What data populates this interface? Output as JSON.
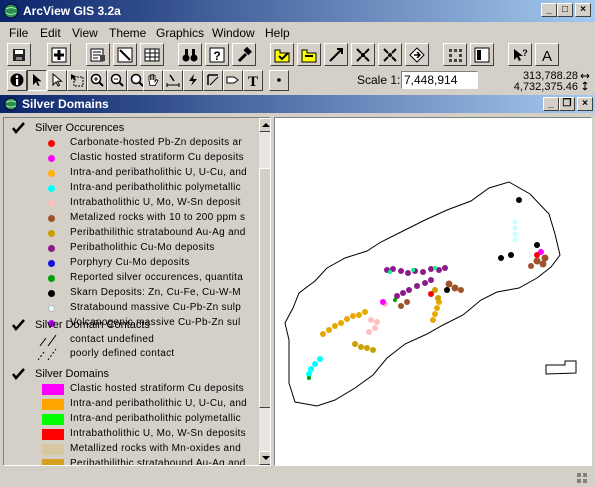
{
  "app": {
    "title": "ArcView GIS 3.2a"
  },
  "menu": [
    "File",
    "Edit",
    "View",
    "Theme",
    "Graphics",
    "Window",
    "Help"
  ],
  "toolbar": {
    "scale_label": "Scale 1:",
    "scale_value": "7,448,914",
    "coord_x": "313,788.28",
    "coord_y": "4,732,375.46"
  },
  "view": {
    "title": "Silver Domains",
    "themes": [
      {
        "name": "Silver Occurences",
        "checked": true,
        "items": [
          {
            "label": "Carbonate-hosted Pb-Zn deposits ar",
            "color": "#ff0000"
          },
          {
            "label": "Clastic hosted stratiform Cu deposits",
            "color": "#ff00ff"
          },
          {
            "label": "Intra-and peribatholithic U, U-Cu, and",
            "color": "#ffb000"
          },
          {
            "label": "Intra-and peribatholithic polymetallic",
            "color": "#00ffff"
          },
          {
            "label": "Intrabatholithic U, Mo, W-Sn deposit",
            "color": "#ffc0c0"
          },
          {
            "label": "Metalized rocks with 10 to 200 ppm s",
            "color": "#a0522d"
          },
          {
            "label": "Peribathilithic stratabound Au-Ag and",
            "color": "#c8a000"
          },
          {
            "label": "Peribatholithic Cu-Mo deposits",
            "color": "#8b1a8b"
          },
          {
            "label": "Porphyry Cu-Mo deposits",
            "color": "#1010e0"
          },
          {
            "label": "Reported silver occurences, quantita",
            "color": "#00a000"
          },
          {
            "label": "Skarn Deposits: Zn, Cu-Fe, Cu-W-M",
            "color": "#000000"
          },
          {
            "label": "Stratabound massive Cu-Pb-Zn sulp",
            "color": "#e0ffff"
          },
          {
            "label": "Volcanogenic massive Cu-Pb-Zn sul",
            "color": "#c000ff"
          }
        ]
      },
      {
        "name": "Silver Domain Contacts",
        "checked": true,
        "items": [
          {
            "label": "contact undefined"
          },
          {
            "label": "poorly defined contact"
          }
        ]
      },
      {
        "name": "Silver Domains",
        "checked": true,
        "items": [
          {
            "label": "Clastic hosted stratiform Cu deposits",
            "color": "#ff00ff"
          },
          {
            "label": "Intra-and peribatholithic U, U-Cu, and",
            "color": "#ffa500"
          },
          {
            "label": "Intra-and peribatholithic polymetallic",
            "color": "#00ff00"
          },
          {
            "label": "Intrabatholithic U, Mo, W-Sn deposits",
            "color": "#ff0000"
          },
          {
            "label": "Metallized rocks with Mn-oxides and",
            "color": "#d8c8a0"
          },
          {
            "label": "Peribathilithic stratabound Au-Ag and",
            "color": "#d4a020"
          }
        ]
      }
    ]
  }
}
